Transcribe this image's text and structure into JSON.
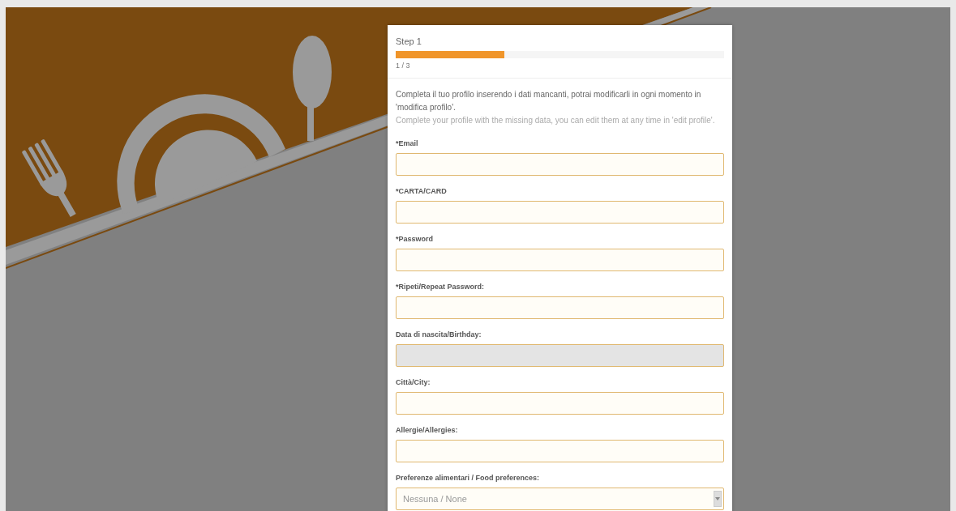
{
  "progress": {
    "title": "Step 1",
    "level": 0.33,
    "counter": "1 / 3"
  },
  "intro": {
    "italian": "Completa il tuo profilo inserendo i dati mancanti, potrai modificarli in ogni momento in 'modifica profilo'.",
    "english": "Complete your profile with the missing data, you can edit them at any time in 'edit profile'."
  },
  "fields": [
    {
      "kind": "text",
      "label": "*Email",
      "disabled": false
    },
    {
      "kind": "text",
      "label": "*CARTA/CARD",
      "disabled": false
    },
    {
      "kind": "text",
      "label": "*Password",
      "disabled": false
    },
    {
      "kind": "text",
      "label": "*Ripeti/Repeat Password:",
      "disabled": false
    },
    {
      "kind": "text",
      "label": "Data di nascita/Birthday:",
      "disabled": true
    },
    {
      "kind": "text",
      "label": "Città/City:",
      "disabled": false
    },
    {
      "kind": "text",
      "label": "Allergie/Allergies:",
      "disabled": false
    },
    {
      "kind": "select",
      "label": "Preferenze alimentari / Food preferences:",
      "value": "Nessuna / None",
      "disabled": false
    }
  ]
}
